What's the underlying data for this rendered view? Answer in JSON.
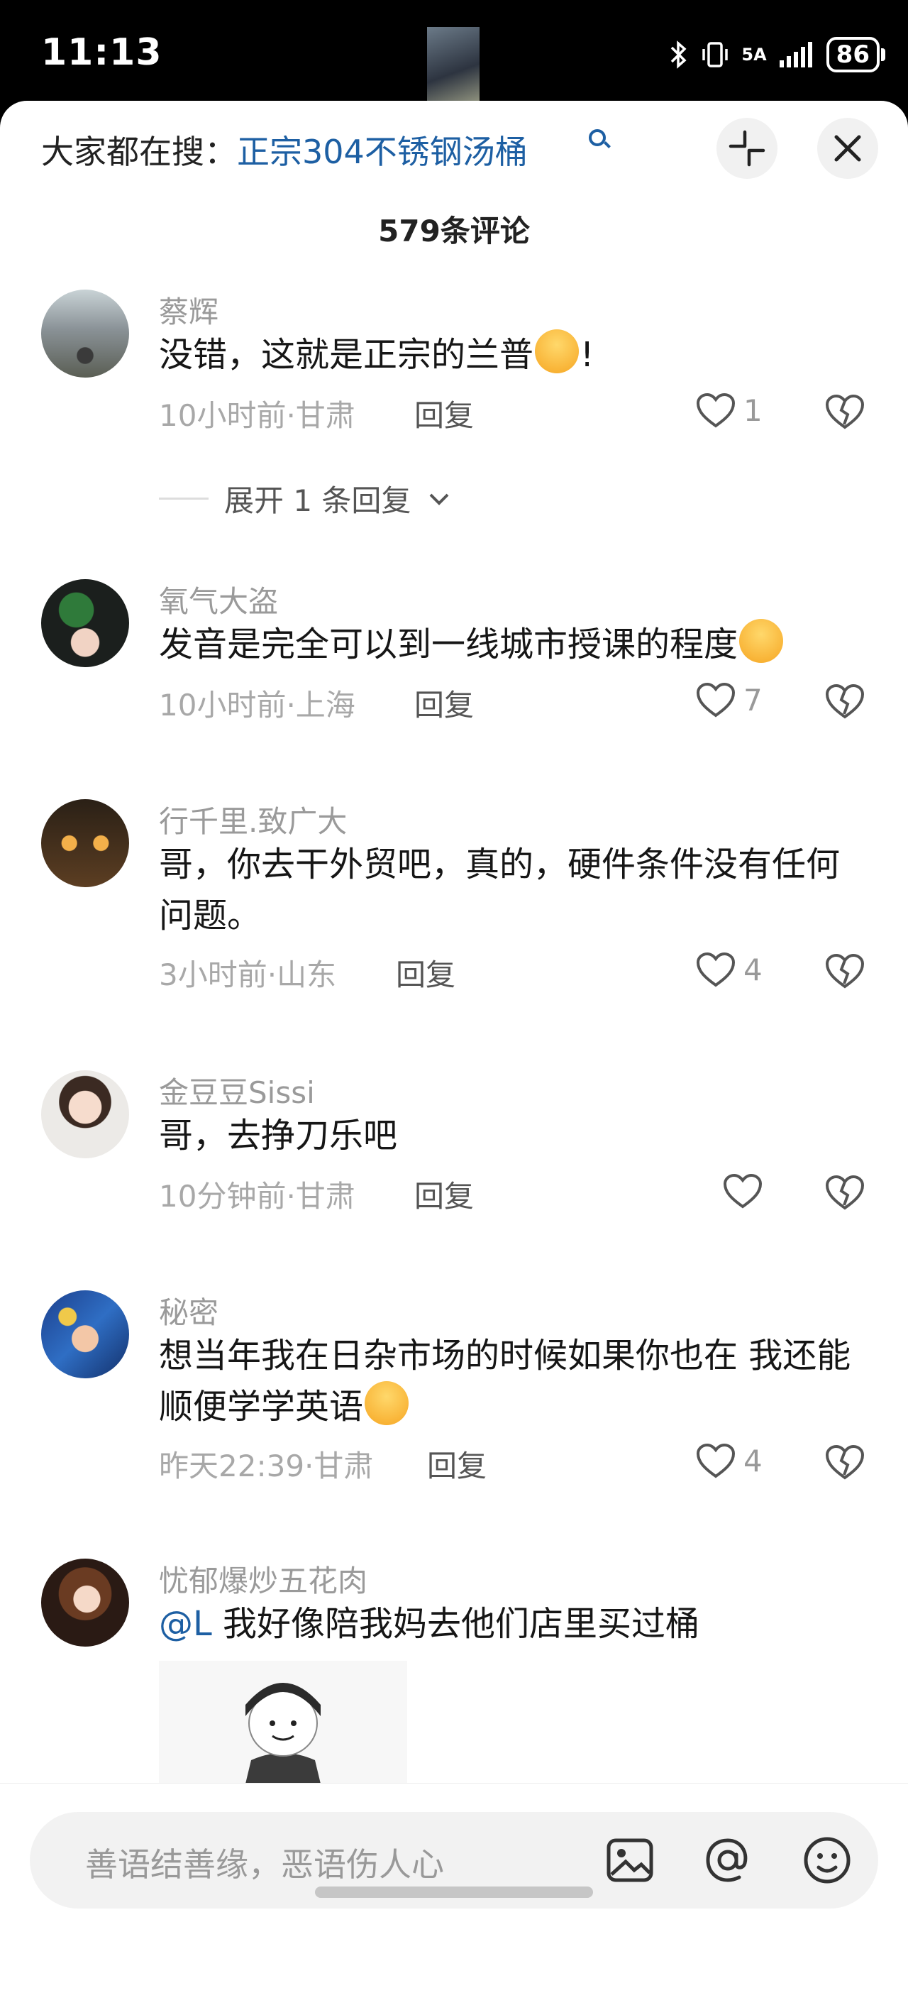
{
  "status": {
    "time": "11:13",
    "network": "5A",
    "battery": "86"
  },
  "header": {
    "search_prefix": "大家都在搜：",
    "search_term": "正宗304不锈钢汤桶",
    "comment_count": "579条评论"
  },
  "comments": [
    {
      "user": "蔡辉",
      "text": "没错，这就是正宗的兰普",
      "text_tail": "!",
      "emoji": "sleepy-emoji",
      "time_loc": "10小时前·甘肃",
      "reply": "回复",
      "likes": "1",
      "expand": "展开 1 条回复"
    },
    {
      "user": "氧气大盗",
      "text": "发音是完全可以到一线城市授课的程度",
      "emoji": "tearful-emoji",
      "time_loc": "10小时前·上海",
      "reply": "回复",
      "likes": "7"
    },
    {
      "user": "行千里.致广大",
      "text": "哥，你去干外贸吧，真的，硬件条件没有任何问题。",
      "time_loc": "3小时前·山东",
      "reply": "回复",
      "likes": "4"
    },
    {
      "user": "金豆豆Sissi",
      "text": "哥，去挣刀乐吧",
      "time_loc": "10分钟前·甘肃",
      "reply": "回复",
      "likes": ""
    },
    {
      "user": "秘密",
      "text": "想当年我在日杂市场的时候如果你也在 我还能顺便学学英语",
      "emoji": "laughing-crying-emoji",
      "time_loc": "昨天22:39·甘肃",
      "reply": "回复",
      "likes": "4"
    },
    {
      "user": "忧郁爆炒五花肉",
      "mention": "@L",
      "text": " 我好像陪我妈去他们店里买过桶"
    }
  ],
  "input": {
    "placeholder": "善语结善缘，恶语伤人心"
  },
  "colors": {
    "link": "#1d5fa3",
    "muted": "#9a9a9a",
    "text": "#161616",
    "emoji": "#f6b23a"
  },
  "icons": [
    "bluetooth-icon",
    "vibrate-icon",
    "signal-icon",
    "battery-icon",
    "search-icon",
    "collapse-icon",
    "close-icon",
    "heart-icon",
    "dislike-heart-icon",
    "chevron-down-icon",
    "image-icon",
    "at-icon",
    "emoji-icon"
  ]
}
